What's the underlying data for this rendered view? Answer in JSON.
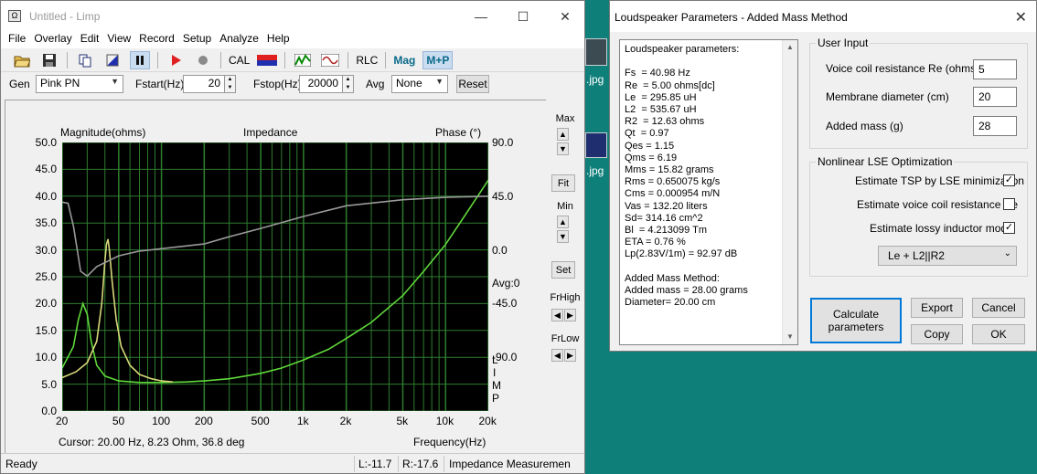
{
  "desktop": {
    "labels": [
      ".jpg",
      ".jpg"
    ]
  },
  "limp": {
    "title": "Untitled - Limp",
    "menu": [
      "File",
      "Overlay",
      "Edit",
      "View",
      "Record",
      "Setup",
      "Analyze",
      "Help"
    ],
    "toolbar": {
      "cal": "CAL",
      "rlc": "RLC",
      "mag": "Mag",
      "mp": "M+P"
    },
    "gen": {
      "label": "Gen",
      "value": "Pink PN",
      "fstart_label": "Fstart(Hz)",
      "fstart": "20",
      "fstop_label": "Fstop(Hz)",
      "fstop": "20000",
      "avg_label": "Avg",
      "avg": "None",
      "reset": "Reset"
    },
    "plot": {
      "left_title": "Magnitude(ohms)",
      "center_title": "Impedance",
      "right_title": "Phase (°)",
      "avg_label": "Avg:0",
      "limp_vertical": [
        "L",
        "I",
        "M",
        "P"
      ],
      "cursor": "Cursor: 20.00 Hz, 8.23 Ohm, 36.8 deg",
      "xlabel": "Frequency(Hz)"
    },
    "side": {
      "max": "Max",
      "fit": "Fit",
      "min": "Min",
      "set": "Set",
      "frhigh": "FrHigh",
      "frlow": "FrLow"
    },
    "status": {
      "ready": "Ready",
      "l": "L:-11.7",
      "r": "R:-17.6",
      "mode": "Impedance Measuremen"
    }
  },
  "chart_data": {
    "type": "line",
    "title": "Impedance",
    "xscale": "log",
    "xlim": [
      20,
      20000
    ],
    "ylim": [
      0,
      50
    ],
    "y2lim": [
      -135,
      90
    ],
    "x_ticks": [
      "20",
      "50",
      "100",
      "200",
      "500",
      "1k",
      "2k",
      "5k",
      "10k",
      "20k"
    ],
    "y_ticks": [
      "0.0",
      "5.0",
      "10.0",
      "15.0",
      "20.0",
      "25.0",
      "30.0",
      "35.0",
      "40.0",
      "45.0",
      "50.0"
    ],
    "y2_ticks": [
      "90.0",
      "45.0",
      "0.0",
      "-45.0",
      "-90.0"
    ],
    "xlabel": "Frequency(Hz)",
    "ylabel": "Magnitude(ohms)",
    "y2label": "Phase (°)",
    "grid": true,
    "colors": {
      "background": "#000000",
      "grid": "#2e7d2e",
      "green_trace": "#5fd83a",
      "yellow_trace": "#d7d77a",
      "gray_trace": "#9a9a9a"
    },
    "series": [
      {
        "axis": "left",
        "color": "green",
        "points": [
          [
            20,
            8
          ],
          [
            24,
            12
          ],
          [
            26,
            17
          ],
          [
            28,
            20
          ],
          [
            30,
            18
          ],
          [
            32,
            13
          ],
          [
            35,
            8.5
          ],
          [
            40,
            6.5
          ],
          [
            50,
            5.6
          ],
          [
            70,
            5.3
          ],
          [
            100,
            5.3
          ],
          [
            150,
            5.4
          ],
          [
            200,
            5.6
          ],
          [
            300,
            6.0
          ],
          [
            500,
            7.0
          ],
          [
            700,
            8.0
          ],
          [
            1000,
            9.5
          ],
          [
            1500,
            11.5
          ],
          [
            2000,
            13.5
          ],
          [
            3000,
            16.5
          ],
          [
            5000,
            21.5
          ],
          [
            7000,
            26
          ],
          [
            10000,
            31
          ],
          [
            15000,
            38
          ],
          [
            20000,
            43
          ]
        ]
      },
      {
        "axis": "left",
        "color": "yellow",
        "points": [
          [
            20,
            6.2
          ],
          [
            25,
            7.3
          ],
          [
            30,
            9
          ],
          [
            35,
            13
          ],
          [
            38,
            20
          ],
          [
            40,
            28
          ],
          [
            41,
            31
          ],
          [
            42,
            32
          ],
          [
            43,
            30
          ],
          [
            45,
            24
          ],
          [
            48,
            17
          ],
          [
            52,
            12
          ],
          [
            60,
            8.5
          ],
          [
            70,
            6.8
          ],
          [
            85,
            6.0
          ],
          [
            100,
            5.6
          ],
          [
            120,
            5.4
          ]
        ]
      },
      {
        "axis": "right",
        "color": "gray",
        "points": [
          [
            20,
            40
          ],
          [
            22,
            39
          ],
          [
            24,
            20
          ],
          [
            27,
            -18
          ],
          [
            30,
            -22
          ],
          [
            35,
            -14
          ],
          [
            50,
            -5
          ],
          [
            70,
            -1
          ],
          [
            100,
            1
          ],
          [
            200,
            5
          ],
          [
            300,
            11
          ],
          [
            500,
            18
          ],
          [
            1000,
            28
          ],
          [
            2000,
            37
          ],
          [
            5000,
            42
          ],
          [
            10000,
            44
          ],
          [
            20000,
            45
          ]
        ]
      }
    ]
  },
  "dialog": {
    "title": "Loudspeaker Parameters - Added Mass Method",
    "params": [
      "Loudspeaker parameters:",
      "",
      "Fs  = 40.98 Hz",
      "Re  = 5.00 ohms[dc]",
      "Le  = 295.85 uH",
      "L2  = 535.67 uH",
      "R2  = 12.63 ohms",
      "Qt  = 0.97",
      "Qes = 1.15",
      "Qms = 6.19",
      "Mms = 15.82 grams",
      "Rms = 0.650075 kg/s",
      "Cms = 0.000954 m/N",
      "Vas = 132.20 liters",
      "Sd= 314.16 cm^2",
      "Bl  = 4.213099 Tm",
      "ETA = 0.76 %",
      "Lp(2.83V/1m) = 92.97 dB",
      "",
      "Added Mass Method:",
      "Added mass = 28.00 grams",
      "Diameter= 20.00 cm"
    ],
    "user_input": {
      "legend": "User Input",
      "re_label": "Voice coil resistance Re (ohms)",
      "re": "5",
      "diam_label": "Membrane diameter (cm)",
      "diam": "20",
      "mass_label": "Added mass (g)",
      "mass": "28"
    },
    "lse": {
      "legend": "Nonlinear LSE Optimization",
      "tsp_label": "Estimate TSP by LSE minimization",
      "re_label": "Estimate voice coil resistance Re",
      "lossy_label": "Estimate lossy inductor model",
      "model": "Le + L2||R2"
    },
    "buttons": {
      "calculate": "Calculate parameters",
      "export": "Export",
      "cancel": "Cancel",
      "copy": "Copy",
      "ok": "OK"
    }
  }
}
